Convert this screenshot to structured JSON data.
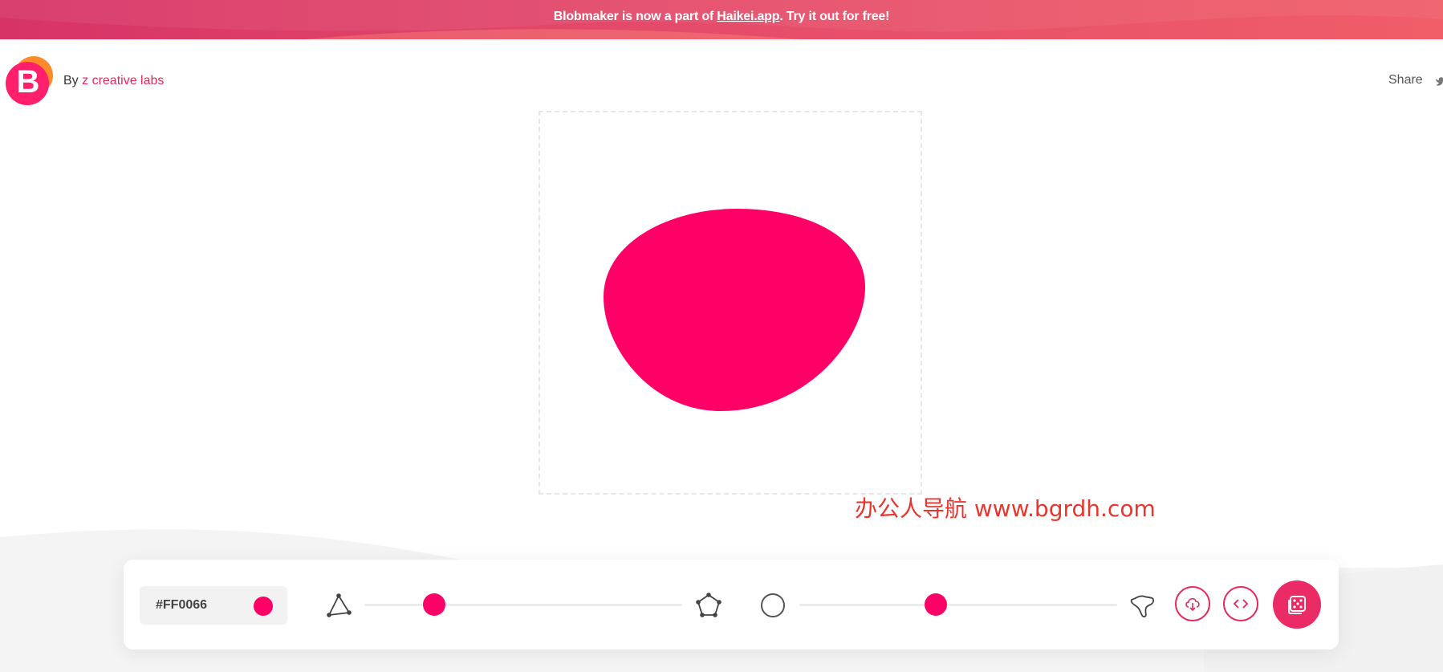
{
  "banner": {
    "prefix": "Blobmaker is now a part of ",
    "link": "Haikei.app",
    "suffix": ". Try it out for free!"
  },
  "header": {
    "logo_letter": "B",
    "by_prefix": "By ",
    "by_link": "z creative labs",
    "share_label": "Share"
  },
  "colors": {
    "accent": "#FF0066",
    "brand": "#e6265c"
  },
  "controls": {
    "color_value": "#FF0066",
    "complexity": 0.22,
    "contrast": 0.43
  },
  "icons": {
    "complexity_min": "triangle-points-icon",
    "complexity_max": "pentagon-points-icon",
    "contrast_min": "circle-icon",
    "contrast_max": "spiky-blob-icon",
    "download": "cloud-download-icon",
    "code": "code-icon",
    "random": "dice-icon",
    "share": "twitter-icon"
  },
  "watermark": "办公人导航  www.bgrdh.com"
}
